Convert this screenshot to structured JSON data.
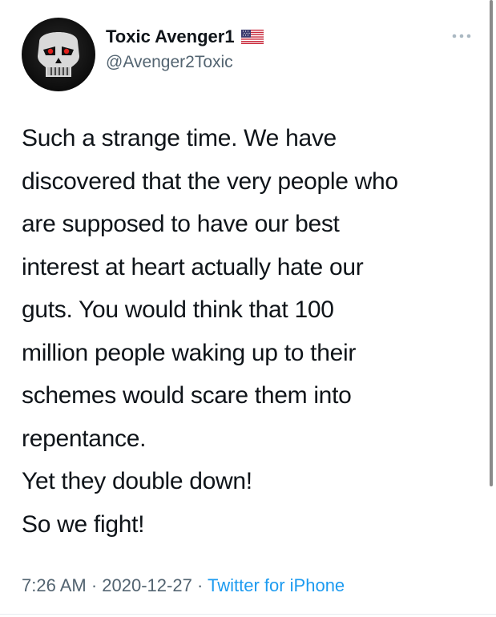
{
  "author": {
    "display_name": "Toxic Avenger1",
    "handle": "@Avenger2Toxic",
    "flag_icon": "us-flag-icon",
    "avatar_icon": "skull-avatar-icon"
  },
  "tweet": {
    "lines": [
      "Such a strange time. We have",
      "discovered that the very people who",
      "are supposed to have our best",
      "interest at heart actually hate our",
      "guts. You would think that 100",
      "million people waking up to their",
      "schemes would scare them into",
      "repentance.",
      "Yet they double down!",
      "So we fight!"
    ]
  },
  "meta": {
    "time": "7:26 AM",
    "separator": " · ",
    "date": "2020-12-27",
    "source": "Twitter for iPhone"
  },
  "menu": {
    "icon": "more-dots-icon"
  },
  "colors": {
    "text": "#0f1419",
    "secondary": "#536471",
    "link": "#1d9bf0"
  }
}
